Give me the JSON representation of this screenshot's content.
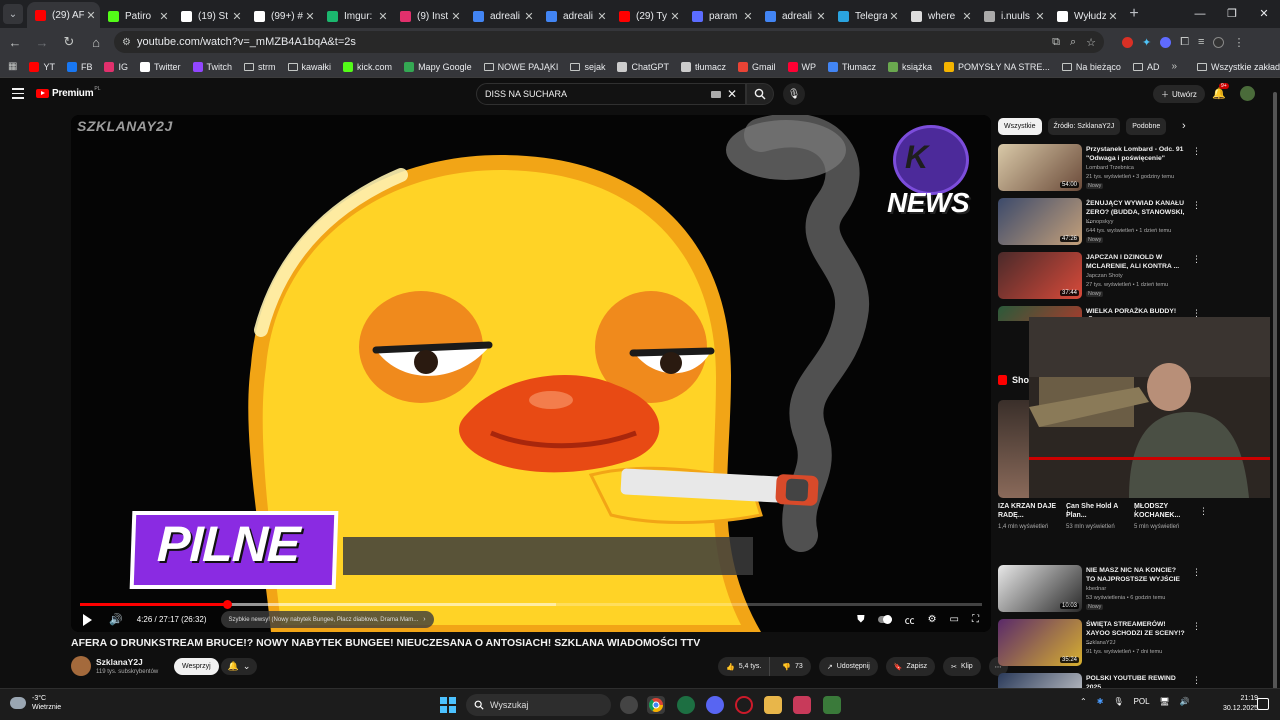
{
  "browser": {
    "tabs": [
      {
        "label": "(29) AF",
        "color": "#ff0000",
        "active": true
      },
      {
        "label": "Patiro",
        "color": "#53fc18"
      },
      {
        "label": "(19) St",
        "color": "#ffffff"
      },
      {
        "label": "(99+) #",
        "color": "#ffffff"
      },
      {
        "label": "Imgur:",
        "color": "#1bb76e"
      },
      {
        "label": "(9) Inst",
        "color": "#e1306c"
      },
      {
        "label": "adreali",
        "color": "#4285f4"
      },
      {
        "label": "adreali",
        "color": "#4285f4"
      },
      {
        "label": "(29) Ty",
        "color": "#ff0000"
      },
      {
        "label": "param",
        "color": "#5b6cff"
      },
      {
        "label": "adreali",
        "color": "#4285f4"
      },
      {
        "label": "Telegra",
        "color": "#2aa3df"
      },
      {
        "label": "where",
        "color": "#dddddd"
      },
      {
        "label": "i.nuuls",
        "color": "#aaaaaa"
      },
      {
        "label": "Wyłudz",
        "color": "#ffffff"
      }
    ],
    "url": "youtube.com/watch?v=_mMZB4A1bqA&t=2s",
    "bookmarks": [
      {
        "label": "YT",
        "kind": "icon",
        "color": "#ff0000"
      },
      {
        "label": "FB",
        "kind": "icon",
        "color": "#1877f2"
      },
      {
        "label": "IG",
        "kind": "icon",
        "color": "#e1306c"
      },
      {
        "label": "Twitter",
        "kind": "icon",
        "color": "#ffffff"
      },
      {
        "label": "Twitch",
        "kind": "icon",
        "color": "#9146ff"
      },
      {
        "label": "strm",
        "kind": "folder"
      },
      {
        "label": "kawałki",
        "kind": "folder"
      },
      {
        "label": "kick.com",
        "kind": "icon",
        "color": "#53fc18"
      },
      {
        "label": "Mapy Google",
        "kind": "icon",
        "color": "#34a853"
      },
      {
        "label": "NOWE PAJĄKI",
        "kind": "folder"
      },
      {
        "label": "sejak",
        "kind": "folder"
      },
      {
        "label": "ChatGPT",
        "kind": "icon",
        "color": "#cccccc"
      },
      {
        "label": "tłumacz",
        "kind": "icon",
        "color": "#cccccc"
      },
      {
        "label": "Gmail",
        "kind": "icon",
        "color": "#ea4335"
      },
      {
        "label": "WP",
        "kind": "icon",
        "color": "#ff0033"
      },
      {
        "label": "Tłumacz",
        "kind": "icon",
        "color": "#4285f4"
      },
      {
        "label": "książka",
        "kind": "icon",
        "color": "#6aa84f"
      },
      {
        "label": "POMYSŁY NA STRE...",
        "kind": "icon",
        "color": "#f4b400"
      },
      {
        "label": "Na bieżąco",
        "kind": "folder"
      },
      {
        "label": "AD",
        "kind": "folder"
      }
    ],
    "all_bookmarks": "Wszystkie zakładki"
  },
  "youtube": {
    "logo_text": "Premium",
    "logo_region": "PL",
    "search_query": "DISS NA SUCHARA",
    "create_label": "Utwórz",
    "notif_count": "9+"
  },
  "player": {
    "watermark": "SZKLANAY2J",
    "news_label": "NEWS",
    "banner": "PILNE",
    "time": "4:26 / 27:17 (26:32)",
    "chapter": "Szybkie newsy! (Nowy nabytek Bungee, Płacz diabłowa, Drama Mam...",
    "progress_played": 0.163,
    "progress_loaded": 0.528
  },
  "video": {
    "title": "AFERA O DRUNKSTREAM BRUCE!? NOWY NABYTEK BUNGEE! NIEUCZESANA O ANTOSIACH! SZKLANA WIADOMOŚCI TTV",
    "channel": "SzklanaY2J",
    "subscribers": "119 tys. subskrybentów",
    "support": "Wesprzyj",
    "likes": "5,4 tys.",
    "dislikes": "73",
    "share": "Udostępnij",
    "save": "Zapisz",
    "clip": "Klip"
  },
  "sidebar": {
    "chips": [
      "Wszystkie",
      "Źródło: SzklanaY2J",
      "Podobne"
    ],
    "recommended": [
      {
        "title": "Przystanek Lombard - Odc. 91 \"Odwaga i poświęcenie\"",
        "channel": "Lombard Trzebnica",
        "meta": "21 tys. wyświetleń • 3 godziny temu",
        "badge": "Nowy",
        "duration": "54:00",
        "colors": [
          "#d9c9a8",
          "#6b4b3a"
        ]
      },
      {
        "title": "ŻENUJĄCY WYWIAD KANAŁU ZERO? (BUDDA, STANOWSKI, ...",
        "channel": "Konopskyy",
        "meta": "644 tys. wyświetleń • 1 dzień temu",
        "badge": "Nowy",
        "duration": "47:26",
        "colors": [
          "#3c4a6b",
          "#c4a07a"
        ]
      },
      {
        "title": "JAPCZAN I DZINOLD W MCLARENIE, ALI KONTRA ...",
        "channel": "Japczan Shoty",
        "meta": "27 tys. wyświetleń • 1 dzień temu",
        "badge": "Nowy",
        "duration": "37:44",
        "colors": [
          "#4a2a2a",
          "#d84a3a"
        ]
      },
      {
        "title": "WIELKA PORAŻKA BUDDY! 🎗",
        "channel": "",
        "meta": "",
        "badge": "",
        "duration": "",
        "colors": [
          "#2a5a3a",
          "#c8342a"
        ]
      },
      {
        "title": "NIE MASZ NIC NA KONCIE? TO NAJPROSTSZE WYJŚCIE",
        "channel": "kbednar",
        "meta": "53 wyświetlenia • 6 godzin temu",
        "badge": "Nowy",
        "duration": "10:03",
        "colors": [
          "#e8e8e8",
          "#2a2a2a"
        ]
      },
      {
        "title": "ŚWIĘTA STREAMERÓW! XAYOO SCHODZI ZE SCENY!? ...",
        "channel": "SzklanaY2J",
        "meta": "91 tys. wyświetleń • 7 dni temu",
        "badge": "",
        "duration": "35:24",
        "colors": [
          "#5a2a6a",
          "#d8b030"
        ]
      },
      {
        "title": "POLSKI YOUTUBE REWIND 2025",
        "channel": "",
        "meta": "",
        "badge": "",
        "duration": "",
        "colors": [
          "#2a3a5a",
          "#d8d8d8"
        ]
      }
    ],
    "shorts_label": "Shorts",
    "shorts": [
      {
        "title": "IZA KRZAN DAJE RADĘ...",
        "views": "1,4 mln wyświetleń",
        "colors": [
          "#3a2f2a",
          "#8a6a5a"
        ]
      },
      {
        "title": "Can She Hold A Plan...",
        "views": "53 mln wyświetleń",
        "colors": [
          "#2f5a2a",
          "#5aa04a"
        ]
      },
      {
        "title": "MŁODSZY KOCHANEK...",
        "views": "5 mln wyświetleń",
        "colors": [
          "#2a2a3a",
          "#6a5a5a"
        ]
      }
    ]
  },
  "taskbar": {
    "temperature": "-3°C",
    "weather": "Wietrznie",
    "search_placeholder": "Wyszukaj",
    "lang": "POL",
    "time": "21:19",
    "date": "30.12.2025"
  }
}
